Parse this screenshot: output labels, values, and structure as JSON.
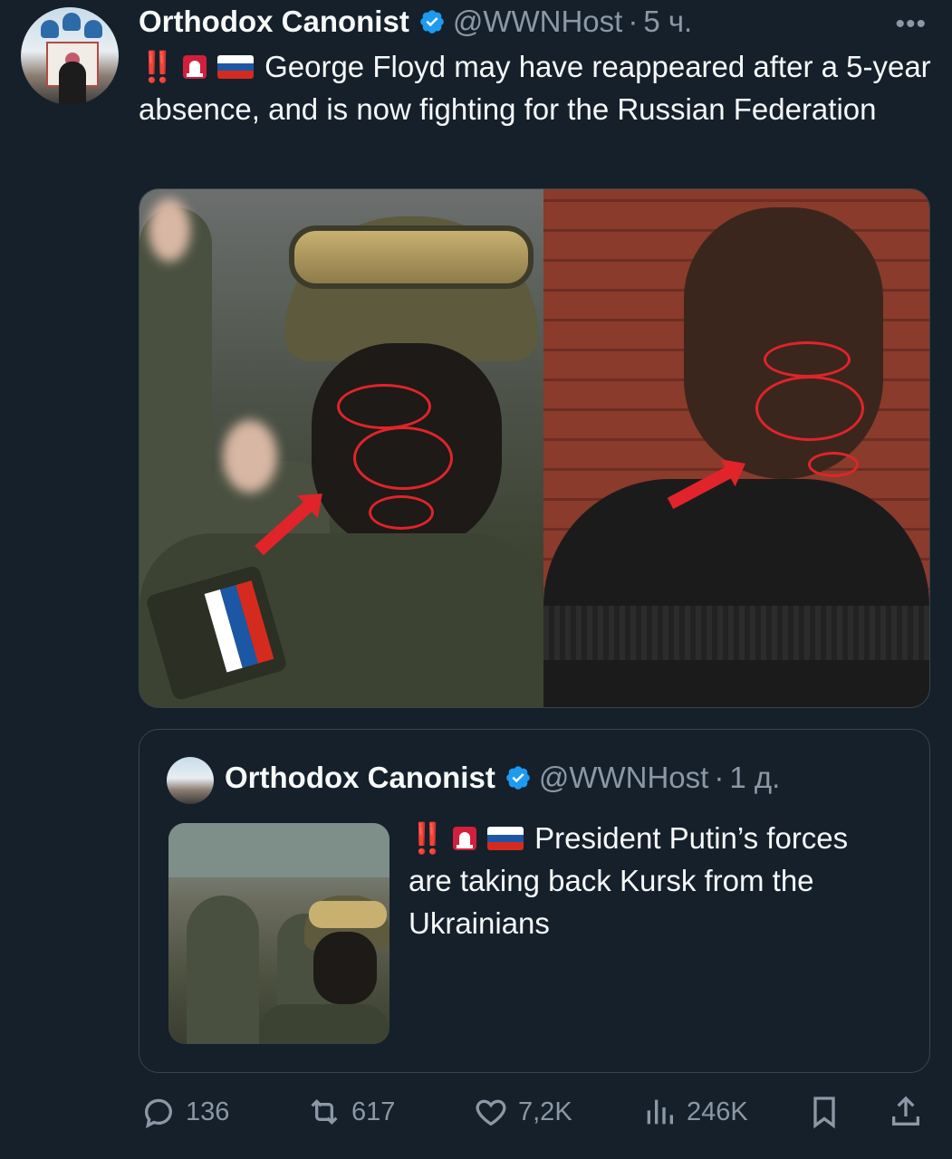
{
  "post": {
    "author_name": "Orthodox Canonist",
    "handle": "@WWNHost",
    "separator": "·",
    "time": "5 ч.",
    "more_label": "•••",
    "text_prefix": "‼️",
    "text": "George Floyd may have reappeared after a 5-year absence, and is now fighting for the Russian Federation"
  },
  "quoted_post": {
    "author_name": "Orthodox Canonist",
    "handle": "@WWNHost",
    "separator": "·",
    "time": "1 д.",
    "text_prefix": "‼️",
    "text": "President Putin’s forces are taking back Kursk from the Ukrainians"
  },
  "actions": {
    "replies": "136",
    "reposts": "617",
    "likes": "7,2K",
    "views": "246K"
  },
  "colors": {
    "background": "#15202b",
    "text": "#f7f9f9",
    "muted": "#8b98a5",
    "verified": "#1d9bf0",
    "annotation_red": "#e0242a"
  },
  "icons": [
    "more-icon",
    "verified-icon",
    "siren-icon",
    "russia-flag-icon",
    "reply-icon",
    "repost-icon",
    "like-icon",
    "views-icon",
    "bookmark-icon",
    "share-icon"
  ]
}
